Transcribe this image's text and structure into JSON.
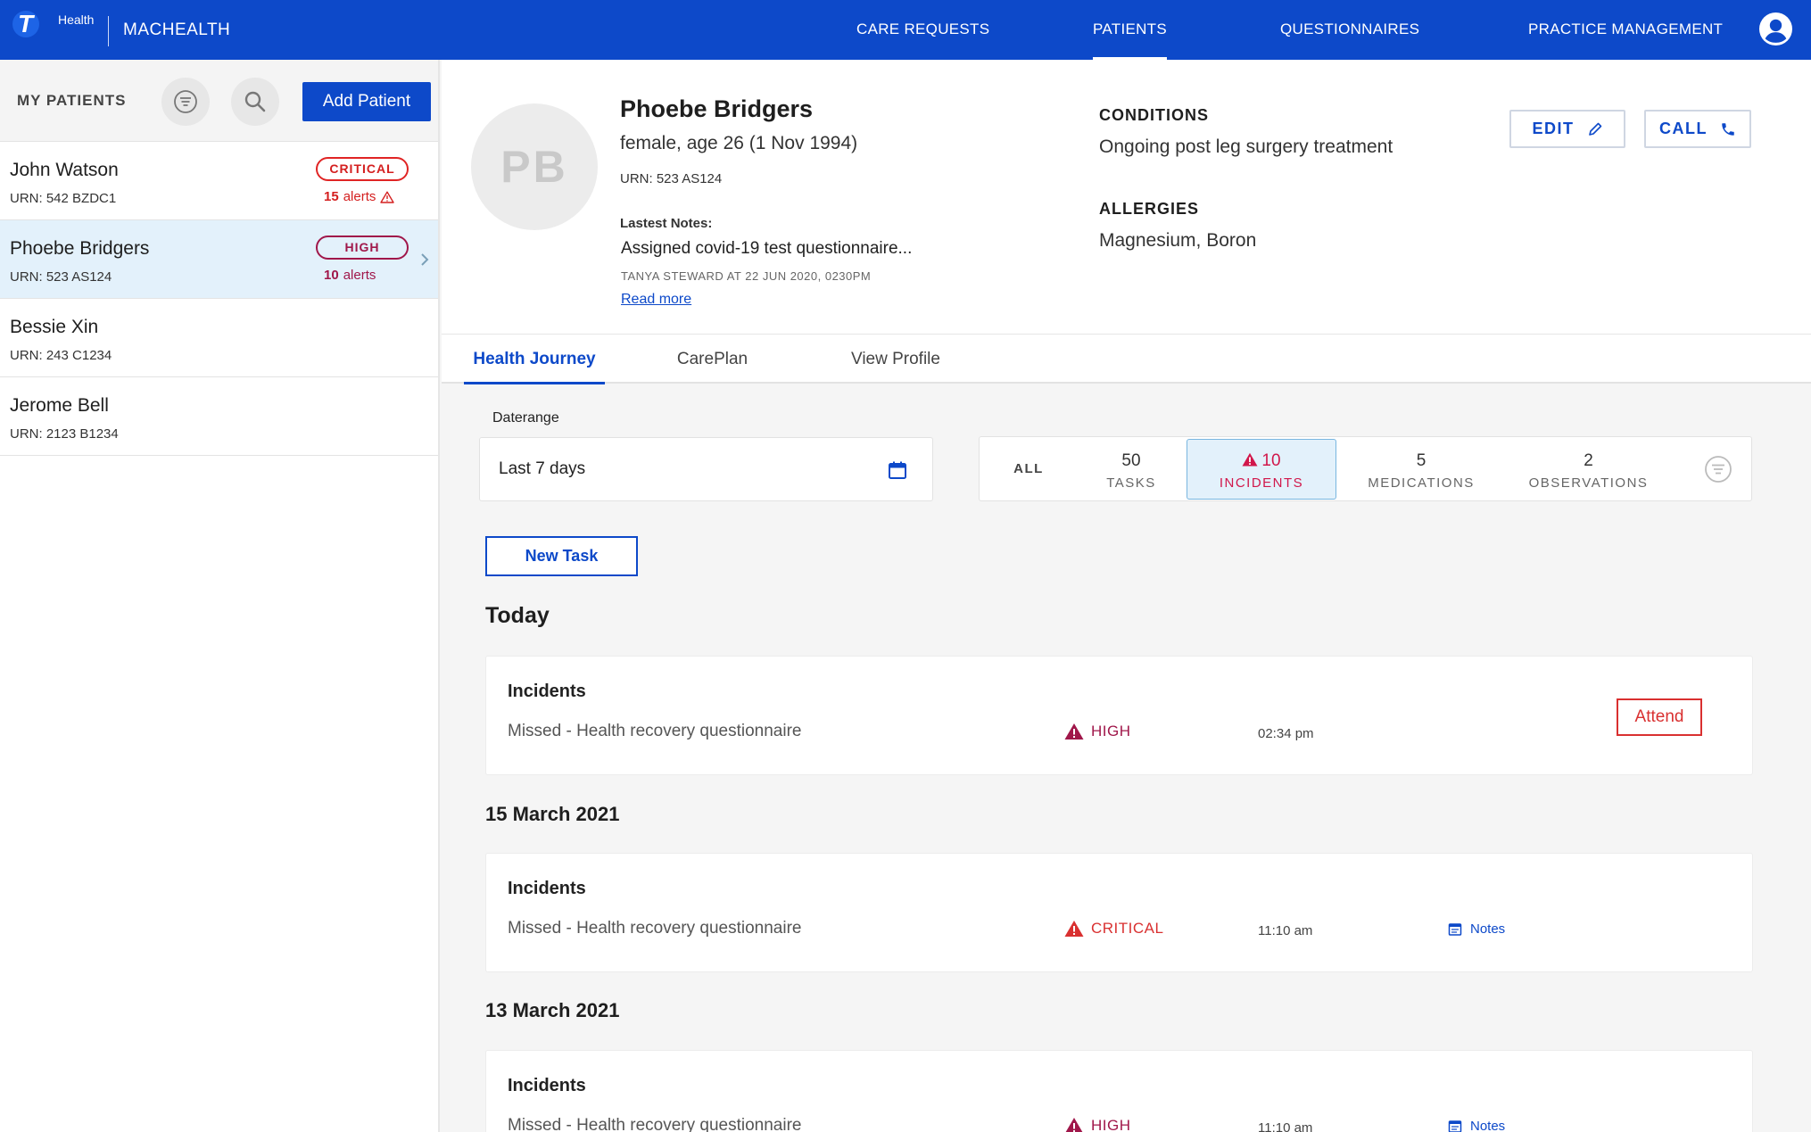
{
  "header": {
    "brand_sub": "Health",
    "brand_name": "MACHEALTH",
    "nav": [
      "CARE REQUESTS",
      "PATIENTS",
      "QUESTIONNAIRES",
      "PRACTICE MANAGEMENT"
    ],
    "active_nav": "PATIENTS",
    "colors": {
      "primary": "#0d49c9"
    }
  },
  "sidebar": {
    "title": "MY PATIENTS",
    "add_label": "Add Patient",
    "patients": [
      {
        "name": "John Watson",
        "urn": "URN: 542 BZDC1",
        "badge": "CRITICAL",
        "alert_count": "15",
        "alert_label": "alerts",
        "alert_color": "#d41f1f"
      },
      {
        "name": "Phoebe Bridgers",
        "urn": "URN: 523 AS124",
        "badge": "HIGH",
        "alert_count": "10",
        "alert_label": "alerts",
        "alert_color": "#a0174a",
        "selected": true
      },
      {
        "name": "Bessie Xin",
        "urn": "URN: 243 C1234"
      },
      {
        "name": "Jerome Bell",
        "urn": "URN: 2123 B1234"
      }
    ]
  },
  "patient": {
    "initials": "PB",
    "name": "Phoebe Bridgers",
    "demographics": "female, age 26 (1 Nov 1994)",
    "urn": "URN: 523 AS124",
    "notes_label": "Lastest Notes:",
    "notes_text": "Assigned covid-19 test questionnaire...",
    "notes_meta": "TANYA STEWARD AT 22 JUN 2020, 0230PM",
    "read_more": "Read more",
    "conditions_label": "CONDITIONS",
    "conditions": "Ongoing post leg surgery treatment",
    "allergies_label": "ALLERGIES",
    "allergies": "Magnesium, Boron",
    "edit_label": "EDIT",
    "call_label": "CALL"
  },
  "tabs": [
    "Health Journey",
    "CarePlan",
    "View Profile"
  ],
  "active_tab": "Health Journey",
  "daterange": {
    "label": "Daterange",
    "value": "Last 7 days"
  },
  "filters": {
    "all_label": "ALL",
    "items": [
      {
        "count": "50",
        "label": "TASKS"
      },
      {
        "count": "10",
        "label": "INCIDENTS",
        "selected": true
      },
      {
        "count": "5",
        "label": "MEDICATIONS"
      },
      {
        "count": "2",
        "label": "OBSERVATIONS"
      }
    ]
  },
  "new_task_label": "New Task",
  "timeline": [
    {
      "heading": "Today",
      "card": {
        "title": "Incidents",
        "desc": "Missed - Health recovery questionnaire",
        "severity": "HIGH",
        "severity_color": "#a0174a",
        "time": "02:34 pm",
        "action": "Attend"
      }
    },
    {
      "heading": "15 March 2021",
      "card": {
        "title": "Incidents",
        "desc": "Missed - Health recovery questionnaire",
        "severity": "CRITICAL",
        "severity_color": "#d93030",
        "time": "11:10 am",
        "link": "Notes"
      }
    },
    {
      "heading": "13 March 2021",
      "card": {
        "title": "Incidents",
        "desc": "Missed - Health recovery questionnaire",
        "severity": "HIGH",
        "severity_color": "#a0174a",
        "time": "11:10 am",
        "link": "Notes"
      }
    }
  ]
}
